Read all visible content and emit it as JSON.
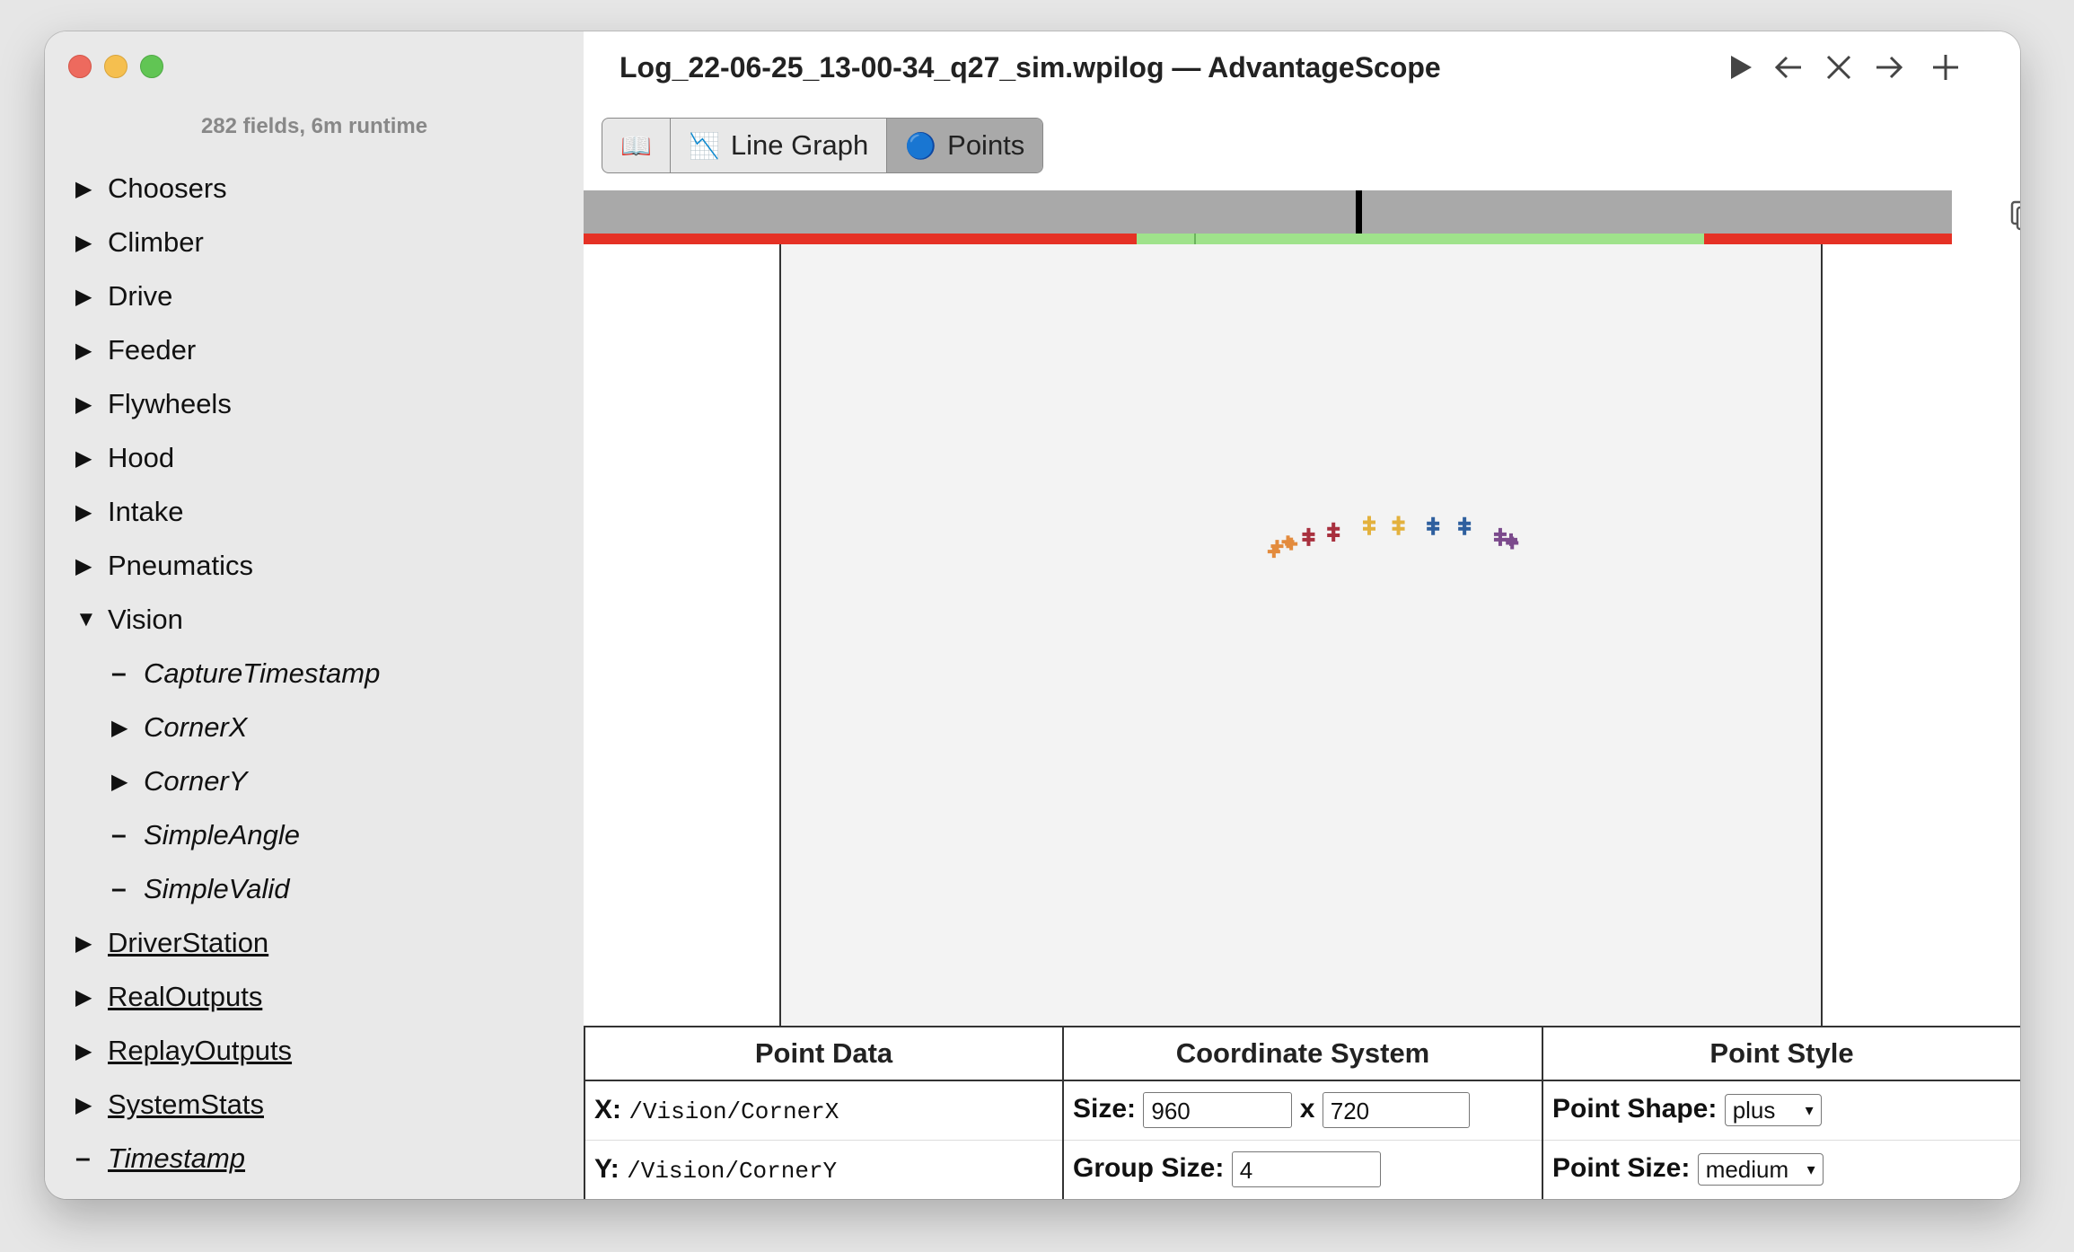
{
  "app": {
    "title": "Log_22-06-25_13-00-34_q27_sim.wpilog — AdvantageScope"
  },
  "sidebar": {
    "summary": "282 fields, 6m runtime",
    "items": [
      {
        "label": "Choosers",
        "expanded": false
      },
      {
        "label": "Climber",
        "expanded": false
      },
      {
        "label": "Drive",
        "expanded": false
      },
      {
        "label": "Feeder",
        "expanded": false
      },
      {
        "label": "Flywheels",
        "expanded": false
      },
      {
        "label": "Hood",
        "expanded": false
      },
      {
        "label": "Intake",
        "expanded": false
      },
      {
        "label": "Pneumatics",
        "expanded": false
      },
      {
        "label": "Vision",
        "expanded": true
      },
      {
        "label": "CaptureTimestamp",
        "leaf": true
      },
      {
        "label": "CornerX",
        "expanded": false
      },
      {
        "label": "CornerY",
        "expanded": false
      },
      {
        "label": "SimpleAngle",
        "leaf": true
      },
      {
        "label": "SimpleValid",
        "leaf": true
      },
      {
        "label": "DriverStation",
        "expanded": false
      },
      {
        "label": "RealOutputs",
        "expanded": false
      },
      {
        "label": "ReplayOutputs",
        "expanded": false
      },
      {
        "label": "SystemStats",
        "expanded": false
      },
      {
        "label": "Timestamp",
        "leaf": true
      }
    ]
  },
  "tabs": [
    {
      "label": "",
      "icon": "book-icon"
    },
    {
      "label": "Line Graph",
      "icon": "line-graph-icon"
    },
    {
      "label": "Points",
      "icon": "blue-circle-icon",
      "active": true
    }
  ],
  "toolbar": {
    "play_icon": "play-icon",
    "back_icon": "arrow-left-icon",
    "close_icon": "close-icon",
    "forward_icon": "arrow-right-icon",
    "add_icon": "plus-icon"
  },
  "controls": {
    "headers": {
      "point_data": "Point Data",
      "coordinate_system": "Coordinate System",
      "point_style": "Point Style"
    },
    "x_label": "X:",
    "x_value": "/Vision/CornerX",
    "y_label": "Y:",
    "y_value": "/Vision/CornerY",
    "size_label": "Size:",
    "size_width": "960",
    "size_sep": "x",
    "size_height": "720",
    "group_size_label": "Group Size:",
    "group_size": "4",
    "point_shape_label": "Point Shape:",
    "point_shape": "plus",
    "point_size_label": "Point Size:",
    "point_size": "medium"
  },
  "colors": {
    "timeline_gray": "#a9a9a9",
    "range_red": "#e53125",
    "range_green": "#9fe28b",
    "point_groups": [
      "#e38b3d",
      "#a8303e",
      "#e3b13d",
      "#2e5f9e",
      "#7b4a8c"
    ]
  },
  "timeline": {
    "cursor_fraction": 0.564,
    "enabled_ranges": [
      [
        0.404,
        0.819
      ]
    ]
  },
  "points": {
    "coordinate_width": 960,
    "coordinate_height": 720,
    "groups": [
      {
        "color_index": 0,
        "points": [
          [
            455,
            283
          ],
          [
            458,
            278
          ],
          [
            468,
            274
          ],
          [
            471,
            276
          ]
        ]
      },
      {
        "color_index": 1,
        "points": [
          [
            487,
            267
          ],
          [
            487,
            272
          ],
          [
            510,
            262
          ],
          [
            510,
            268
          ]
        ]
      },
      {
        "color_index": 2,
        "points": [
          [
            543,
            262
          ],
          [
            543,
            256
          ],
          [
            570,
            256
          ],
          [
            570,
            262
          ]
        ]
      },
      {
        "color_index": 3,
        "points": [
          [
            602,
            262
          ],
          [
            602,
            257
          ],
          [
            631,
            257
          ],
          [
            631,
            262
          ]
        ]
      },
      {
        "color_index": 4,
        "points": [
          [
            664,
            267
          ],
          [
            664,
            272
          ],
          [
            674,
            272
          ],
          [
            675,
            275
          ]
        ]
      }
    ]
  }
}
